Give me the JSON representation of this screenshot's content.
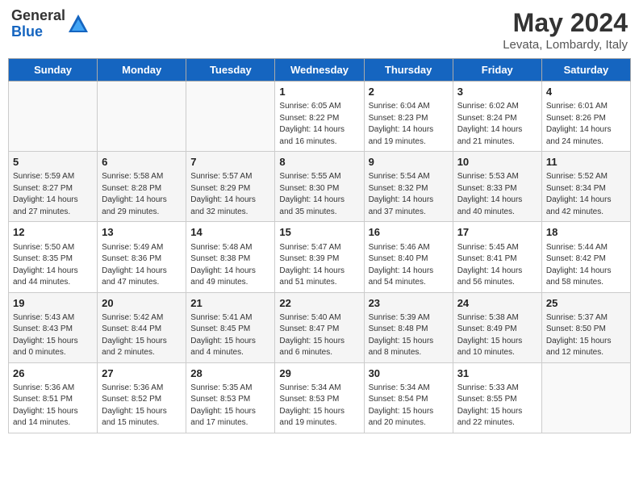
{
  "header": {
    "logo_general": "General",
    "logo_blue": "Blue",
    "month_year": "May 2024",
    "location": "Levata, Lombardy, Italy"
  },
  "weekdays": [
    "Sunday",
    "Monday",
    "Tuesday",
    "Wednesday",
    "Thursday",
    "Friday",
    "Saturday"
  ],
  "weeks": [
    [
      {
        "day": "",
        "info": ""
      },
      {
        "day": "",
        "info": ""
      },
      {
        "day": "",
        "info": ""
      },
      {
        "day": "1",
        "info": "Sunrise: 6:05 AM\nSunset: 8:22 PM\nDaylight: 14 hours\nand 16 minutes."
      },
      {
        "day": "2",
        "info": "Sunrise: 6:04 AM\nSunset: 8:23 PM\nDaylight: 14 hours\nand 19 minutes."
      },
      {
        "day": "3",
        "info": "Sunrise: 6:02 AM\nSunset: 8:24 PM\nDaylight: 14 hours\nand 21 minutes."
      },
      {
        "day": "4",
        "info": "Sunrise: 6:01 AM\nSunset: 8:26 PM\nDaylight: 14 hours\nand 24 minutes."
      }
    ],
    [
      {
        "day": "5",
        "info": "Sunrise: 5:59 AM\nSunset: 8:27 PM\nDaylight: 14 hours\nand 27 minutes."
      },
      {
        "day": "6",
        "info": "Sunrise: 5:58 AM\nSunset: 8:28 PM\nDaylight: 14 hours\nand 29 minutes."
      },
      {
        "day": "7",
        "info": "Sunrise: 5:57 AM\nSunset: 8:29 PM\nDaylight: 14 hours\nand 32 minutes."
      },
      {
        "day": "8",
        "info": "Sunrise: 5:55 AM\nSunset: 8:30 PM\nDaylight: 14 hours\nand 35 minutes."
      },
      {
        "day": "9",
        "info": "Sunrise: 5:54 AM\nSunset: 8:32 PM\nDaylight: 14 hours\nand 37 minutes."
      },
      {
        "day": "10",
        "info": "Sunrise: 5:53 AM\nSunset: 8:33 PM\nDaylight: 14 hours\nand 40 minutes."
      },
      {
        "day": "11",
        "info": "Sunrise: 5:52 AM\nSunset: 8:34 PM\nDaylight: 14 hours\nand 42 minutes."
      }
    ],
    [
      {
        "day": "12",
        "info": "Sunrise: 5:50 AM\nSunset: 8:35 PM\nDaylight: 14 hours\nand 44 minutes."
      },
      {
        "day": "13",
        "info": "Sunrise: 5:49 AM\nSunset: 8:36 PM\nDaylight: 14 hours\nand 47 minutes."
      },
      {
        "day": "14",
        "info": "Sunrise: 5:48 AM\nSunset: 8:38 PM\nDaylight: 14 hours\nand 49 minutes."
      },
      {
        "day": "15",
        "info": "Sunrise: 5:47 AM\nSunset: 8:39 PM\nDaylight: 14 hours\nand 51 minutes."
      },
      {
        "day": "16",
        "info": "Sunrise: 5:46 AM\nSunset: 8:40 PM\nDaylight: 14 hours\nand 54 minutes."
      },
      {
        "day": "17",
        "info": "Sunrise: 5:45 AM\nSunset: 8:41 PM\nDaylight: 14 hours\nand 56 minutes."
      },
      {
        "day": "18",
        "info": "Sunrise: 5:44 AM\nSunset: 8:42 PM\nDaylight: 14 hours\nand 58 minutes."
      }
    ],
    [
      {
        "day": "19",
        "info": "Sunrise: 5:43 AM\nSunset: 8:43 PM\nDaylight: 15 hours\nand 0 minutes."
      },
      {
        "day": "20",
        "info": "Sunrise: 5:42 AM\nSunset: 8:44 PM\nDaylight: 15 hours\nand 2 minutes."
      },
      {
        "day": "21",
        "info": "Sunrise: 5:41 AM\nSunset: 8:45 PM\nDaylight: 15 hours\nand 4 minutes."
      },
      {
        "day": "22",
        "info": "Sunrise: 5:40 AM\nSunset: 8:47 PM\nDaylight: 15 hours\nand 6 minutes."
      },
      {
        "day": "23",
        "info": "Sunrise: 5:39 AM\nSunset: 8:48 PM\nDaylight: 15 hours\nand 8 minutes."
      },
      {
        "day": "24",
        "info": "Sunrise: 5:38 AM\nSunset: 8:49 PM\nDaylight: 15 hours\nand 10 minutes."
      },
      {
        "day": "25",
        "info": "Sunrise: 5:37 AM\nSunset: 8:50 PM\nDaylight: 15 hours\nand 12 minutes."
      }
    ],
    [
      {
        "day": "26",
        "info": "Sunrise: 5:36 AM\nSunset: 8:51 PM\nDaylight: 15 hours\nand 14 minutes."
      },
      {
        "day": "27",
        "info": "Sunrise: 5:36 AM\nSunset: 8:52 PM\nDaylight: 15 hours\nand 15 minutes."
      },
      {
        "day": "28",
        "info": "Sunrise: 5:35 AM\nSunset: 8:53 PM\nDaylight: 15 hours\nand 17 minutes."
      },
      {
        "day": "29",
        "info": "Sunrise: 5:34 AM\nSunset: 8:53 PM\nDaylight: 15 hours\nand 19 minutes."
      },
      {
        "day": "30",
        "info": "Sunrise: 5:34 AM\nSunset: 8:54 PM\nDaylight: 15 hours\nand 20 minutes."
      },
      {
        "day": "31",
        "info": "Sunrise: 5:33 AM\nSunset: 8:55 PM\nDaylight: 15 hours\nand 22 minutes."
      },
      {
        "day": "",
        "info": ""
      }
    ]
  ]
}
